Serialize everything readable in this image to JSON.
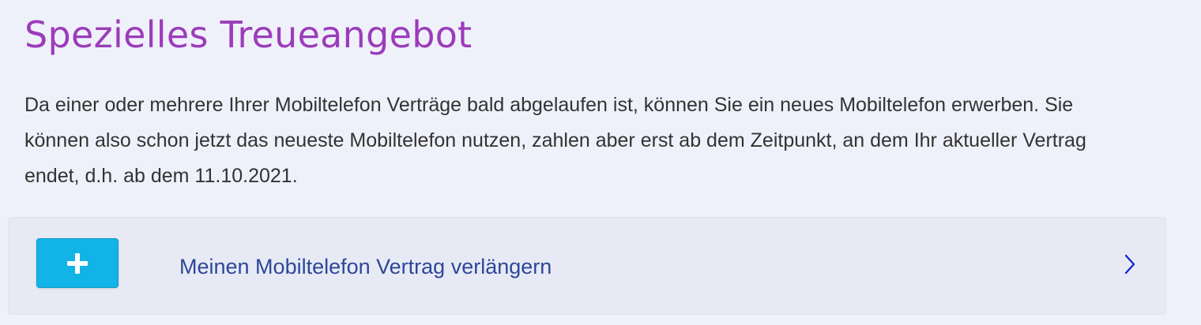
{
  "page": {
    "title": "Spezielles Treueangebot",
    "intro": "Da einer oder mehrere Ihrer Mobiltelefon Verträge bald abgelaufen ist, können Sie ein neues Mobiltelefon erwerben. Sie können also schon jetzt das neueste Mobiltelefon nutzen, zahlen aber erst ab dem Zeitpunkt, an dem Ihr aktueller Vertrag endet, d.h. ab dem 11.10.2021."
  },
  "action_card": {
    "label": "Meinen Mobiltelefon Vertrag verlängern",
    "button_icon": "plus-icon",
    "arrow_icon": "chevron-right-icon"
  },
  "colors": {
    "background": "#eff1fa",
    "title": "#9b3cba",
    "card_background": "#e7eaf5",
    "button": "#12b3e6",
    "link": "#2e4797",
    "chevron": "#1a28c8"
  }
}
